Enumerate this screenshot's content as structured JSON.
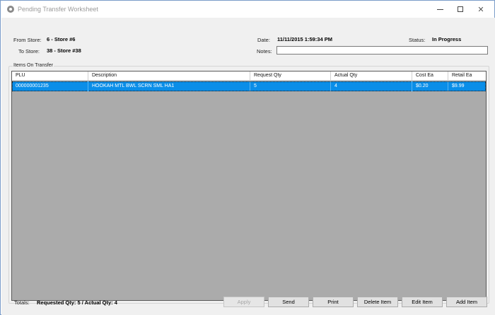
{
  "window": {
    "title": "Pending Transfer Worksheet",
    "app_icon": "app-icon",
    "controls": [
      "minimize-icon",
      "maximize-icon",
      "close-icon"
    ],
    "close_glyph": "✕"
  },
  "header": {
    "from_store_label": "From Store:",
    "from_store_value": "6 - Store #6",
    "to_store_label": "To Store:",
    "to_store_value": "38 - Store #38",
    "date_label": "Date:",
    "date_value": "11/11/2015 1:59:34 PM",
    "status_label": "Status:",
    "status_value": "In Progress",
    "notes_label": "Notes:",
    "notes_value": ""
  },
  "items_group": {
    "label": "Items On Transfer",
    "columns": [
      "PLU",
      "Description",
      "Request Qty",
      "Actual Qty",
      "Cost Ea",
      "Retail Ea"
    ],
    "rows": [
      {
        "plu": "000000001235",
        "description": "HOOKAH MTL BWL SCRN SML HA1",
        "request_qty": "5",
        "actual_qty": "4",
        "cost_ea": "$0.20",
        "retail_ea": "$9.99",
        "selected": true
      }
    ]
  },
  "footer": {
    "totals_label": "Totals:",
    "totals_value": "Requested Qty: 5 / Actual Qty: 4",
    "buttons": {
      "apply": "Apply",
      "send": "Send",
      "print": "Print",
      "delete_item": "Delete Item",
      "edit_item": "Edit Item",
      "add_item": "Add Item"
    }
  },
  "colors": {
    "selection": "#0a8ee8",
    "grid_background": "#ababab",
    "window_border": "#7a9cc9"
  }
}
